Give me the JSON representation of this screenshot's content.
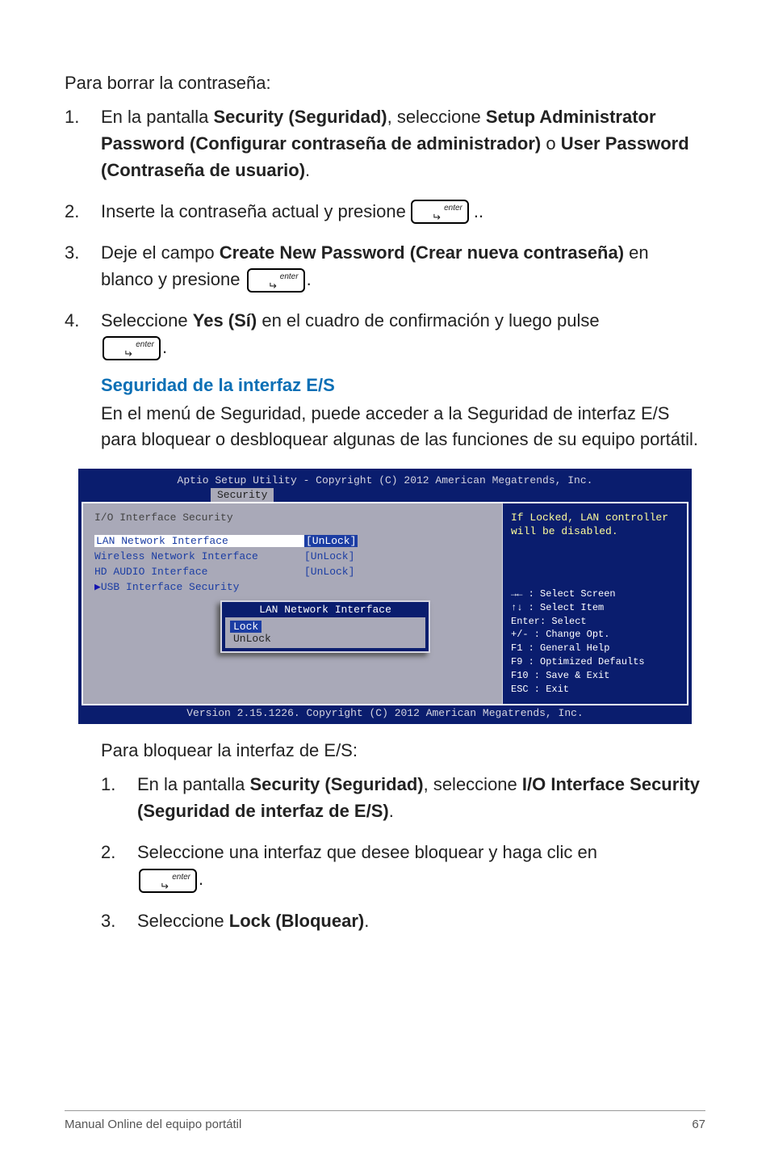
{
  "intro": "Para borrar la contraseña:",
  "steps": [
    {
      "num": "1.",
      "pre": "En la pantalla ",
      "b1": "Security (Seguridad)",
      "mid1": ", seleccione ",
      "b2": "Setup Administrator Password (Configurar contraseña de administrador)",
      "mid2": " o ",
      "b3": "User Password (Contraseña de usuario)",
      "post": "."
    },
    {
      "num": "2.",
      "text": "Inserte la contraseña actual y presione",
      "tail": ".."
    },
    {
      "num": "3.",
      "pre": "Deje el campo ",
      "b1": "Create New Password (Crear nueva contraseña)",
      "mid": " en blanco y presione ",
      "tail": "."
    },
    {
      "num": "4.",
      "pre": "Seleccione ",
      "b1": "Yes (Sí)",
      "mid": " en el cuadro de confirmación y luego pulse",
      "tail": "."
    }
  ],
  "section": {
    "heading": "Seguridad de la interfaz E/S",
    "body": "En el menú de Seguridad, puede acceder a la Seguridad de interfaz E/S para bloquear o desbloquear algunas de las funciones de su equipo portátil."
  },
  "bios": {
    "title": "Aptio Setup Utility - Copyright (C) 2012 American Megatrends, Inc.",
    "tab": "Security",
    "panel_header": "I/O Interface Security",
    "rows": [
      {
        "label": "LAN Network Interface",
        "value": "[UnLock]",
        "hl": true
      },
      {
        "label": "Wireless Network Interface",
        "value": "[UnLock]",
        "hl": false
      },
      {
        "label": "HD AUDIO Interface",
        "value": "[UnLock]",
        "hl": false
      },
      {
        "label": "USB Interface Security",
        "value": "",
        "hl": false
      }
    ],
    "overlay": {
      "title": "LAN Network Interface",
      "lock": "Lock",
      "unlock": "UnLock"
    },
    "right_help": "If Locked, LAN controller will be disabled.",
    "shortcuts": [
      "→←  : Select Screen",
      "↑↓   : Select Item",
      "Enter: Select",
      "+/-  : Change Opt.",
      "F1   : General Help",
      "F9   : Optimized Defaults",
      "F10  : Save & Exit",
      "ESC  : Exit"
    ],
    "footer": "Version 2.15.1226. Copyright (C) 2012 American Megatrends, Inc."
  },
  "after_intro": "Para bloquear la interfaz de E/S:",
  "after_steps": [
    {
      "num": "1.",
      "pre": "En la pantalla ",
      "b1": "Security (Seguridad)",
      "mid": ", seleccione ",
      "b2": "I/O Interface Security (Seguridad de interfaz de E/S)",
      "post": "."
    },
    {
      "num": "2.",
      "text": "Seleccione una interfaz que desee bloquear y haga clic en",
      "tail": "."
    },
    {
      "num": "3.",
      "pre": "Seleccione ",
      "b1": "Lock (Bloquear)",
      "post": "."
    }
  ],
  "footer": {
    "left": "Manual Online del equipo portátil",
    "right": "67"
  }
}
